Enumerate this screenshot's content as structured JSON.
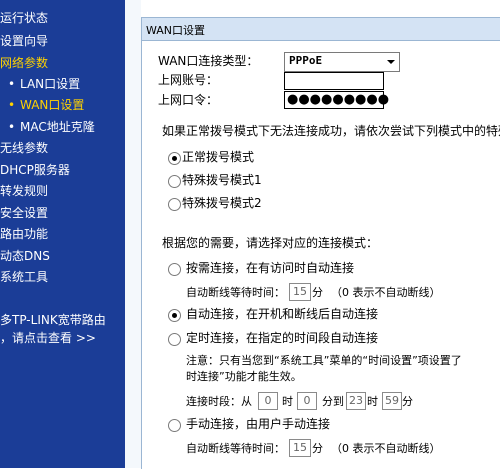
{
  "sidebar": {
    "items": [
      {
        "label": "运行状态"
      },
      {
        "label": "设置向导"
      },
      {
        "label": "网络参数"
      },
      {
        "label": "LAN口设置"
      },
      {
        "label": "WAN口设置"
      },
      {
        "label": "MAC地址克隆"
      },
      {
        "label": "无线参数"
      },
      {
        "label": "DHCP服务器"
      },
      {
        "label": "转发规则"
      },
      {
        "label": "安全设置"
      },
      {
        "label": "路由功能"
      },
      {
        "label": "动态DNS"
      },
      {
        "label": "系统工具"
      }
    ],
    "promo_line1": "多TP-LINK宽带路由",
    "promo_line2": "，请点击查看 >>"
  },
  "panel": {
    "title": "WAN口设置",
    "wan_type_label": "WAN口连接类型：",
    "wan_type_value": "PPPoE",
    "account_label": "上网账号：",
    "account_value": "",
    "password_label": "上网口令：",
    "password_mask": "●●●●●●●●●",
    "fail_hint": "如果正常拨号模式下无法连接成功，请依次尝试下列模式中的特殊",
    "dial_modes": [
      {
        "label": "正常拨号模式",
        "checked": true
      },
      {
        "label": "特殊拨号模式1",
        "checked": false
      },
      {
        "label": "特殊拨号模式2",
        "checked": false
      }
    ],
    "connect_hint": "根据您的需要，请选择对应的连接模式：",
    "on_demand": {
      "label": "按需连接，在有访问时自动连接",
      "idle_label": "自动断线等待时间：",
      "idle_value": "15",
      "idle_unit": "分",
      "idle_note": "（0 表示不自动断线）"
    },
    "auto": {
      "label": "自动连接，在开机和断线后自动连接"
    },
    "timed": {
      "label": "定时连接，在指定的时间段自动连接",
      "note1": "注意：只有当您到“系统工具”菜单的“时间设置”项设置了",
      "note2": "时连接”功能才能生效。",
      "period_label": "连接时段：从",
      "from_hour": "0",
      "hour_unit": "时",
      "from_min": "0",
      "min_to": "分到",
      "to_hour": "23",
      "to_min": "59",
      "min_unit": "分"
    },
    "manual": {
      "label": "手动连接，由用户手动连接",
      "idle_label": "自动断线等待时间：",
      "idle_value": "15",
      "idle_unit": "分",
      "idle_note": "（0 表示不自动断线）"
    }
  }
}
